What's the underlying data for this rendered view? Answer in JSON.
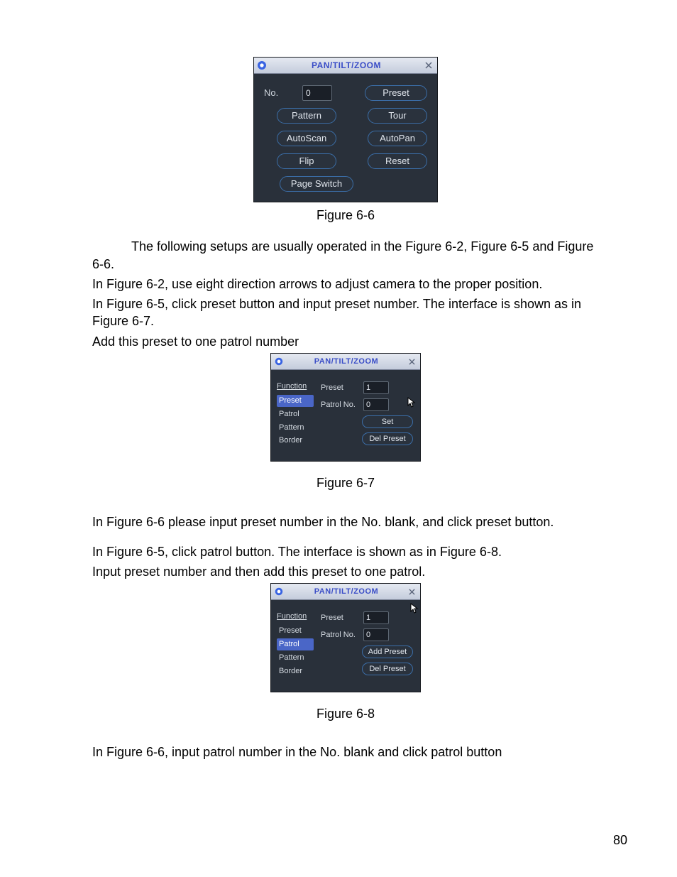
{
  "page_number": "80",
  "fig66": {
    "title": "PAN/TILT/ZOOM",
    "no_label": "No.",
    "no_value": "0",
    "buttons": {
      "preset": "Preset",
      "pattern": "Pattern",
      "tour": "Tour",
      "autoscan": "AutoScan",
      "autopan": "AutoPan",
      "flip": "Flip",
      "reset": "Reset",
      "page_switch": "Page Switch"
    },
    "caption": "Figure 6-6"
  },
  "para1": "The following setups are usually operated in the Figure 6-2, Figure 6-5 and Figure 6-6.",
  "para2": "In Figure 6-2, use eight direction arrows to adjust camera to the proper position.",
  "para3": "In Figure 6-5, click preset button and input preset number. The interface is shown as in Figure 6-7.",
  "para4": "Add this preset to one patrol number",
  "fig67": {
    "title": "PAN/TILT/ZOOM",
    "function_label": "Function",
    "functions": [
      "Preset",
      "Patrol",
      "Pattern",
      "Border"
    ],
    "selected": "Preset",
    "preset_label": "Preset",
    "preset_value": "1",
    "patrol_label": "Patrol No.",
    "patrol_value": "0",
    "buttons": {
      "set": "Set",
      "del_preset": "Del Preset"
    },
    "caption": "Figure 6-7"
  },
  "para5": "In Figure 6-6 please input preset number in the No. blank, and click preset button.",
  "para6": "In Figure 6-5, click patrol button. The interface is shown as in Figure 6-8.",
  "para7": "Input preset number and then add this preset to one patrol.",
  "fig68": {
    "title": "PAN/TILT/ZOOM",
    "function_label": "Function",
    "functions": [
      "Preset",
      "Patrol",
      "Pattern",
      "Border"
    ],
    "selected": "Patrol",
    "preset_label": "Preset",
    "preset_value": "1",
    "patrol_label": "Patrol No.",
    "patrol_value": "0",
    "buttons": {
      "add_preset": "Add Preset",
      "del_preset": "Del Preset"
    },
    "caption": "Figure 6-8"
  },
  "para8": "In Figure 6-6, input patrol number in the No. blank and click patrol button"
}
